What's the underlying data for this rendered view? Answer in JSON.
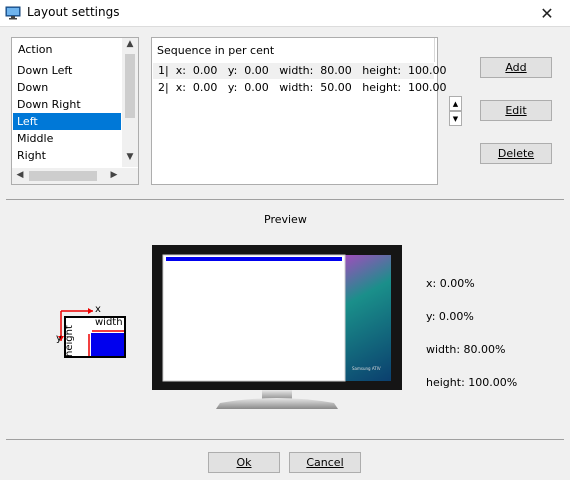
{
  "window": {
    "title": "Layout settings",
    "close_icon": "close-icon"
  },
  "action_list": {
    "header": "Action",
    "items": [
      "Down Left",
      "Down",
      "Down Right",
      "Left",
      "Middle",
      "Right"
    ],
    "selected": "Left"
  },
  "sequence": {
    "header": "Sequence in per cent",
    "rows": [
      "1|  x:  0.00   y:  0.00   width:  80.00   height:  100.00",
      "2|  x:  0.00   y:  0.00   width:  50.00   height:  100.00"
    ]
  },
  "buttons": {
    "add": "Add",
    "edit": "Edit",
    "delete": "Delete",
    "ok": "Ok",
    "cancel": "Cancel"
  },
  "preview": {
    "title": "Preview",
    "x": "x: 0.00%",
    "y": "y: 0.00%",
    "width": "width: 80.00%",
    "height": "height: 100.00%",
    "brand": "Samsung ATIV",
    "highlight_color": "#0000ff"
  },
  "legend": {
    "x": "x",
    "y": "y",
    "width": "width",
    "height": "height"
  }
}
